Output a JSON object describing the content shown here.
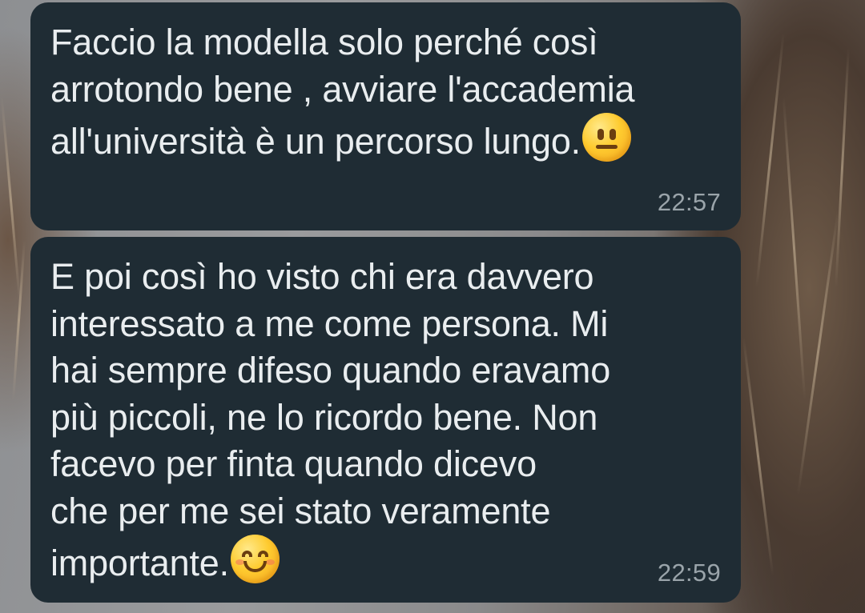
{
  "messages": [
    {
      "text": "Faccio la modella solo perché così\narrotondo bene , avviare l'accademia\nall'università è un percorso lungo.",
      "emoji": "neutral-face-icon",
      "time": "22:57"
    },
    {
      "text": "E poi così ho visto chi era davvero\ninteressato a me come persona. Mi\nhai sempre difeso quando eravamo\npiù piccoli, ne lo ricordo bene. Non\nfacevo per finta quando dicevo\nche per me sei stato veramente\nimportante.",
      "emoji": "smiling-face-icon",
      "time": "22:59"
    }
  ],
  "colors": {
    "bubble_background": "#1f2c34",
    "message_text": "#e9edef",
    "timestamp_text": "#9aa4aa"
  }
}
